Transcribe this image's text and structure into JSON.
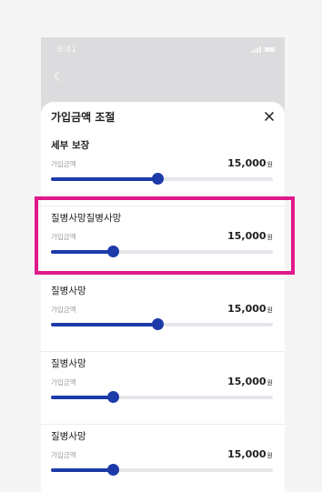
{
  "status_bar": {
    "time": "9:41"
  },
  "sheet": {
    "title": "가입금액 조절",
    "items": [
      {
        "title": "세부 보장",
        "amount_label": "가입금액",
        "amount_value": "15,000",
        "unit": "원",
        "slider_level": 0.48
      },
      {
        "title": "질병사망질병사망",
        "amount_label": "가입금액",
        "amount_value": "15,000",
        "unit": "원",
        "slider_level": 0.28
      },
      {
        "title": "질병사망",
        "amount_label": "가입금액",
        "amount_value": "15,000",
        "unit": "원",
        "slider_level": 0.48
      },
      {
        "title": "질병사망",
        "amount_label": "가입금액",
        "amount_value": "15,000",
        "unit": "원",
        "slider_level": 0.28
      },
      {
        "title": "질병사망",
        "amount_label": "가입금액",
        "amount_value": "15,000",
        "unit": "원",
        "slider_level": 0.28
      }
    ]
  },
  "colors": {
    "accent": "#1d3ba8",
    "highlight": "#e0198a",
    "track": "#e5e6ea"
  }
}
